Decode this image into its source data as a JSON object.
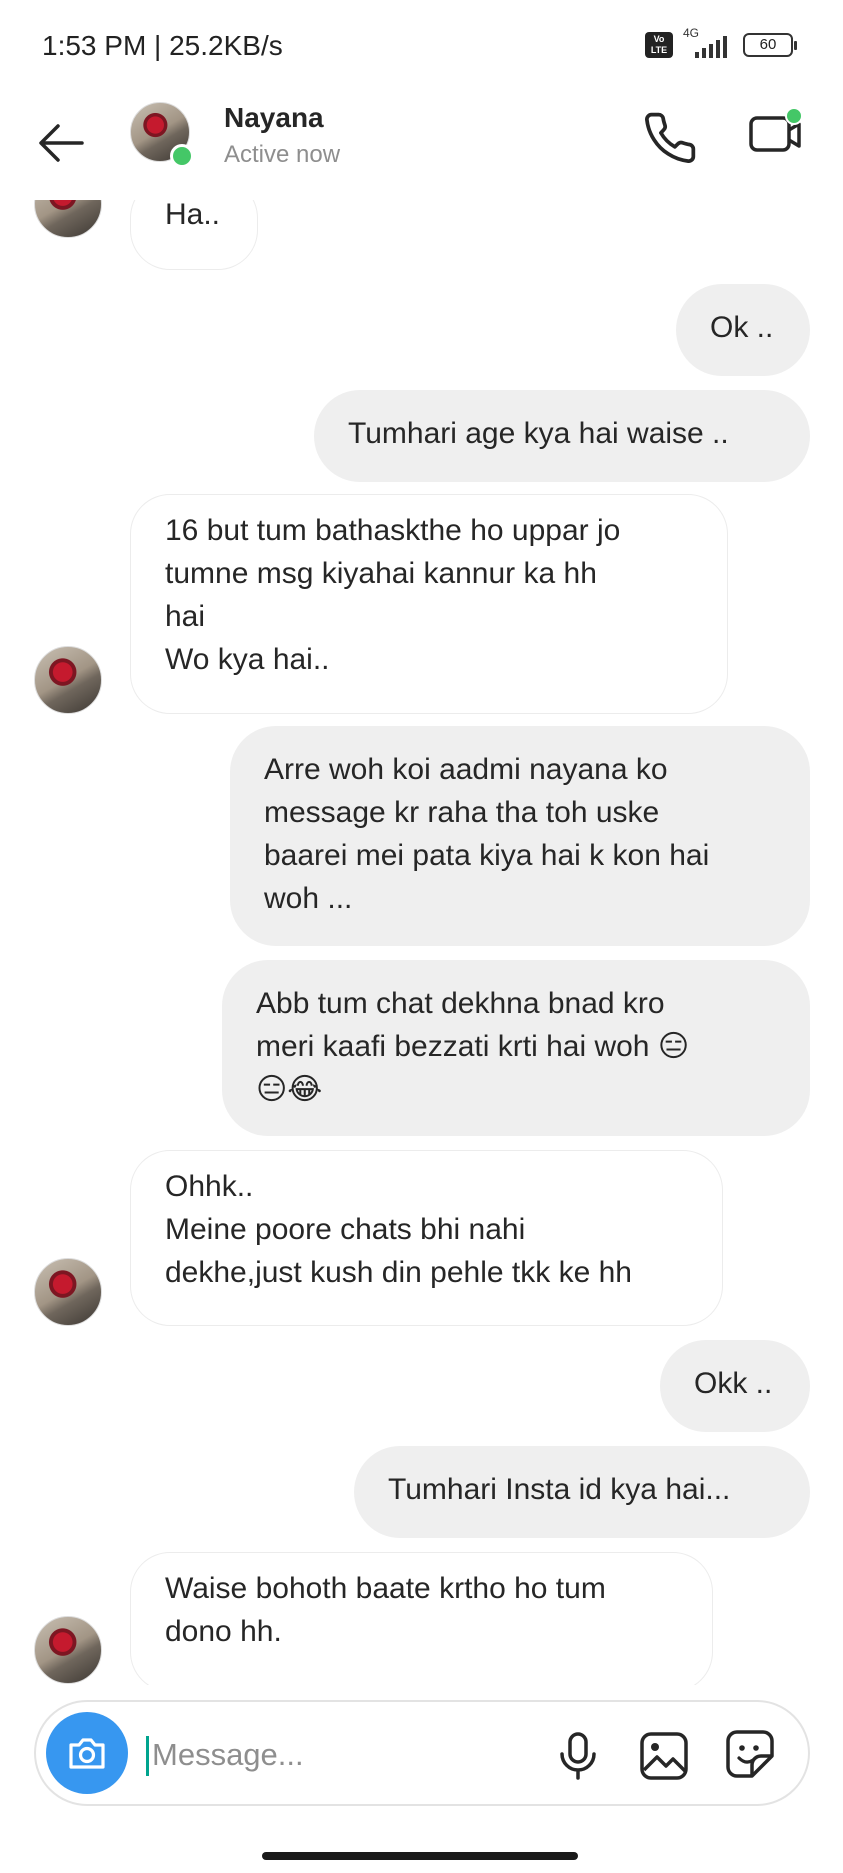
{
  "status_bar": {
    "time_speed": "1:53 PM | 25.2KB/s",
    "volte": "Vo LTE",
    "network": "4G",
    "battery": "60"
  },
  "header": {
    "name": "Nayana",
    "status": "Active now",
    "online_color": "#44c767"
  },
  "messages": [
    {
      "direction": "incoming",
      "text": "Ha.."
    },
    {
      "direction": "outgoing",
      "text": "Ok .."
    },
    {
      "direction": "outgoing",
      "text": "Tumhari age kya hai waise .."
    },
    {
      "direction": "incoming",
      "text": "16 but tum bathaskthe ho uppar jo\ntumne msg kiyahai kannur ka hh\nhai\nWo kya hai.."
    },
    {
      "direction": "outgoing",
      "text": "Arre woh koi aadmi nayana ko\nmessage kr raha tha toh uske\nbaarei mei pata kiya hai k kon hai\nwoh ..."
    },
    {
      "direction": "outgoing",
      "text": "Abb tum chat dekhna bnad kro\nmeri kaafi bezzati krti hai  woh  😑\n😑😂"
    },
    {
      "direction": "incoming",
      "text": "Ohhk..\nMeine poore chats bhi nahi\ndekhe,just kush din pehle tkk ke hh"
    },
    {
      "direction": "outgoing",
      "text": "Okk .."
    },
    {
      "direction": "outgoing",
      "text": "Tumhari Insta id kya hai..."
    },
    {
      "direction": "incoming",
      "text": "Waise bohoth baate krtho ho tum\ndono hh."
    }
  ],
  "composer": {
    "placeholder": "Message...",
    "camera_icon": "camera-icon",
    "mic_icon": "mic-icon",
    "gallery_icon": "gallery-icon",
    "sticker_icon": "sticker-icon",
    "accent_color": "#3797f0"
  }
}
